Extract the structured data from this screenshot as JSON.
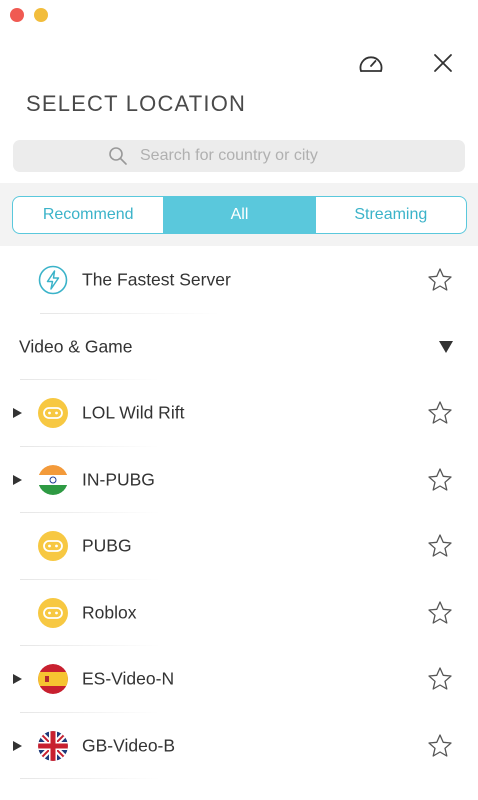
{
  "window": {
    "title": "SELECT LOCATION",
    "close_icon": "close-icon",
    "speed_icon": "speedometer-icon"
  },
  "search": {
    "placeholder": "Search for country or city",
    "value": ""
  },
  "tabs": [
    {
      "label": "Recommend",
      "active": false
    },
    {
      "label": "All",
      "active": true
    },
    {
      "label": "Streaming",
      "active": false
    }
  ],
  "fastest": {
    "label": "The Fastest Server",
    "icon": "lightning-icon"
  },
  "section": {
    "label": "Video & Game",
    "expanded": true
  },
  "items": [
    {
      "label": "LOL Wild Rift",
      "icon": "gamepad-icon",
      "expandable": true
    },
    {
      "label": "IN-PUBG",
      "icon": "india-flag-icon",
      "expandable": true
    },
    {
      "label": "PUBG",
      "icon": "gamepad-icon",
      "expandable": false
    },
    {
      "label": "Roblox",
      "icon": "gamepad-icon",
      "expandable": false
    },
    {
      "label": "ES-Video-N",
      "icon": "spain-flag-icon",
      "expandable": true
    },
    {
      "label": "GB-Video-B",
      "icon": "uk-flag-icon",
      "expandable": true
    }
  ],
  "colors": {
    "accent": "#5ac8dc",
    "game_icon": "#f7c842",
    "close_light": "#f05a52",
    "minimize_light": "#f2bd3c"
  }
}
